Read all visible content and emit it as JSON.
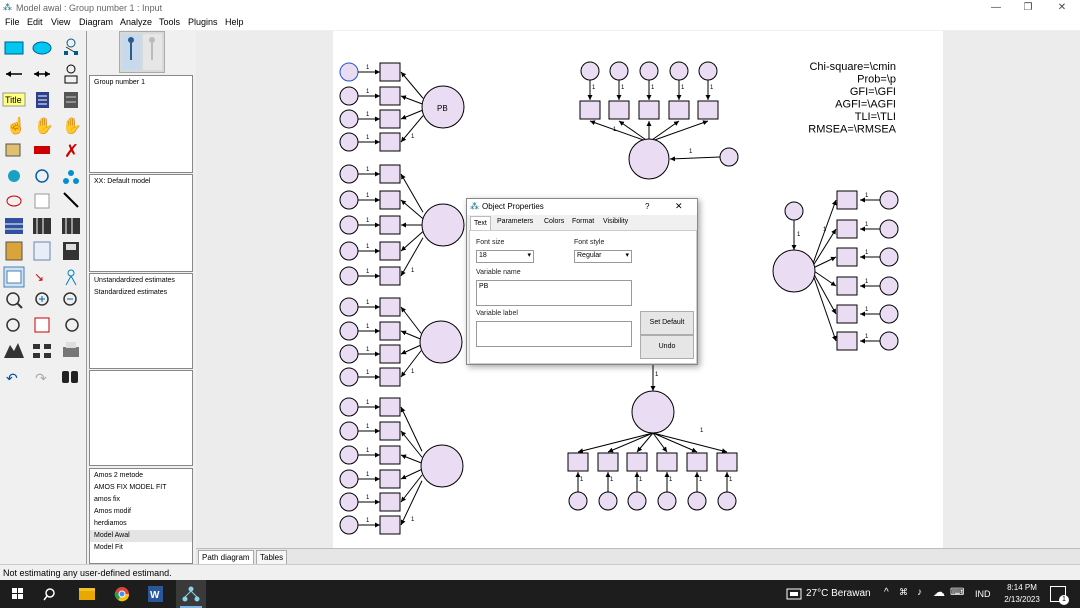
{
  "window": {
    "title": "Model awal : Group number 1 : Input"
  },
  "menu": [
    "File",
    "Edit",
    "View",
    "Diagram",
    "Analyze",
    "Tools",
    "Plugins",
    "Help"
  ],
  "panel": {
    "groups": [
      "Group number 1"
    ],
    "models": [
      "XX: Default model"
    ],
    "estimates": [
      "Unstandardized estimates",
      "Standardized estimates"
    ],
    "files": [
      "Amos 2 metode",
      "AMOS FIX MODEL FIT",
      "amos fix",
      "Amos modif",
      "herdiamos",
      "Model Awal",
      "Model Fit"
    ]
  },
  "view_tabs": [
    "Path diagram",
    "Tables"
  ],
  "status": "Not estimating any user-defined estimand.",
  "diagram": {
    "fit_text": [
      "Chi-square=\\cmin",
      "Prob=\\p",
      "GFI=\\GFI",
      "AGFI=\\AGFI",
      "TLI=\\TLI",
      "RMSEA=\\RMSEA"
    ],
    "latent_label": "PB",
    "path_weight": "1"
  },
  "dialog": {
    "title": "Object Properties",
    "help": "?",
    "close": "✕",
    "tabs": [
      "Text",
      "Parameters",
      "Colors",
      "Format",
      "Visibility"
    ],
    "font_size_label": "Font size",
    "font_size_value": "18",
    "font_style_label": "Font style",
    "font_style_value": "Regular",
    "variable_name_label": "Variable name",
    "variable_name_value": "PB",
    "variable_label_label": "Variable label",
    "variable_label_value": "",
    "set_default": "Set Default",
    "undo": "Undo"
  },
  "taskbar": {
    "weather": "27°C Berawan",
    "lang": "IND",
    "time": "8:14 PM",
    "date": "2/13/2023",
    "notif": "1"
  },
  "colors": {
    "node_fill": "#eadcf2",
    "accent": "#0078d7"
  }
}
